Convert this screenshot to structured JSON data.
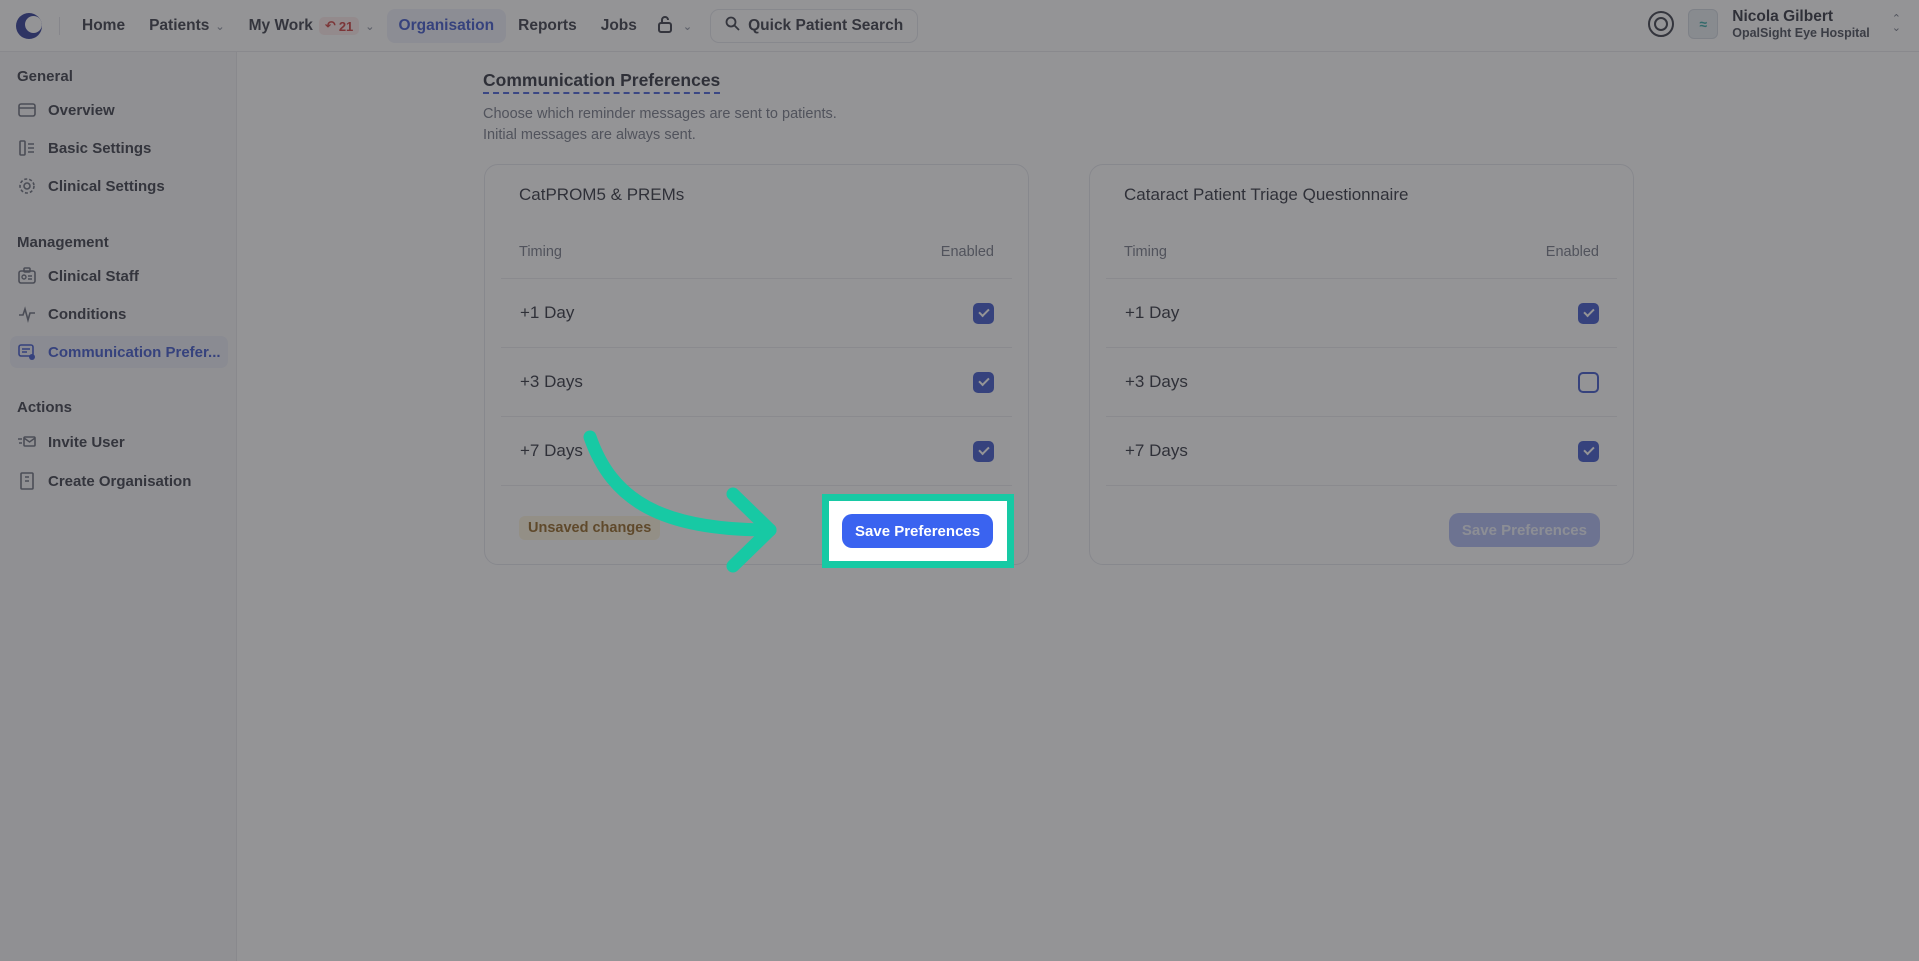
{
  "topbar": {
    "nav": [
      {
        "label": "Home"
      },
      {
        "label": "Patients"
      },
      {
        "label": "My Work",
        "badge": "21"
      },
      {
        "label": "Organisation",
        "active": true
      },
      {
        "label": "Reports"
      },
      {
        "label": "Jobs"
      }
    ],
    "search_label": "Quick Patient Search",
    "user_name": "Nicola Gilbert",
    "user_org": "OpalSight Eye Hospital"
  },
  "sidebar": {
    "sections": {
      "general": "General",
      "management": "Management",
      "actions": "Actions"
    },
    "items": {
      "overview": "Overview",
      "basic_settings": "Basic Settings",
      "clinical_settings": "Clinical Settings",
      "clinical_staff": "Clinical Staff",
      "conditions": "Conditions",
      "communication_preferences": "Communication Prefer...",
      "invite_user": "Invite User",
      "create_organisation": "Create Organisation"
    }
  },
  "main": {
    "title": "Communication Preferences",
    "description_line1": "Choose which reminder messages are sent to patients.",
    "description_line2": "Initial messages are always sent.",
    "cards": [
      {
        "title": "CatPROM5 & PREMs",
        "timing_header": "Timing",
        "enabled_header": "Enabled",
        "rows": [
          {
            "label": "+1 Day",
            "enabled": true
          },
          {
            "label": "+3 Days",
            "enabled": true
          },
          {
            "label": "+7 Days",
            "enabled": true
          }
        ],
        "status": "Unsaved changes",
        "save_label": "Save Preferences",
        "save_enabled": true
      },
      {
        "title": "Cataract Patient Triage Questionnaire",
        "timing_header": "Timing",
        "enabled_header": "Enabled",
        "rows": [
          {
            "label": "+1 Day",
            "enabled": true
          },
          {
            "label": "+3 Days",
            "enabled": false
          },
          {
            "label": "+7 Days",
            "enabled": true
          }
        ],
        "save_label": "Save Preferences",
        "save_enabled": false
      }
    ]
  },
  "colors": {
    "accent": "#2f4ac8",
    "highlight": "#17c9a4",
    "button": "#3a63f0"
  }
}
